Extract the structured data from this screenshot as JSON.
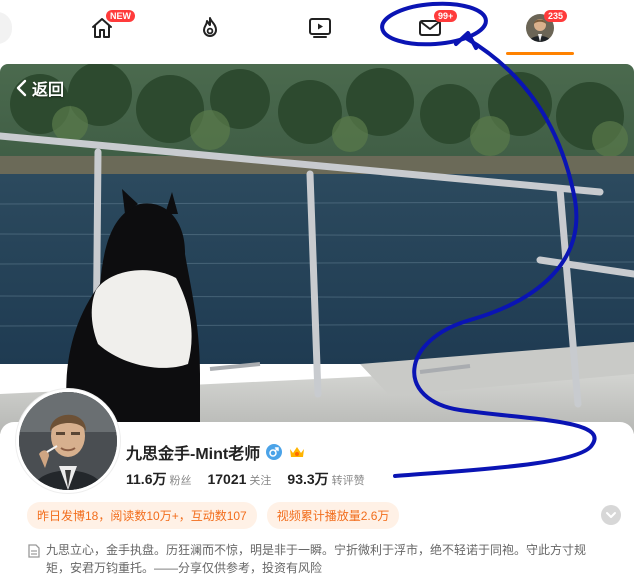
{
  "nav": {
    "home_badge": "NEW",
    "mail_badge": "99+",
    "profile_badge": "235"
  },
  "back_label": "返回",
  "profile": {
    "name": "九思金手-Mint老师",
    "gender": "male",
    "fans_num": "11.6万",
    "fans_label": "粉丝",
    "follow_num": "17021",
    "follow_label": "关注",
    "reposts_num": "93.3万",
    "reposts_label": "转评赞"
  },
  "pills": {
    "yesterday": "昨日发博18，阅读数10万+，互动数107",
    "video": "视频累计播放量2.6万"
  },
  "bio": "九思立心，金手执盘。历狂澜而不惊，明是非于一瞬。宁折微利于浮市，绝不轻诺于同袍。守此方寸规矩，安君万钧重托。——分享仅供参考，投资有风险",
  "colors": {
    "accent": "#ff8200",
    "badge": "#ff3b3b",
    "pill_bg": "#fff1e6",
    "pill_text": "#f26d1c",
    "annotation": "#0a14b4"
  }
}
